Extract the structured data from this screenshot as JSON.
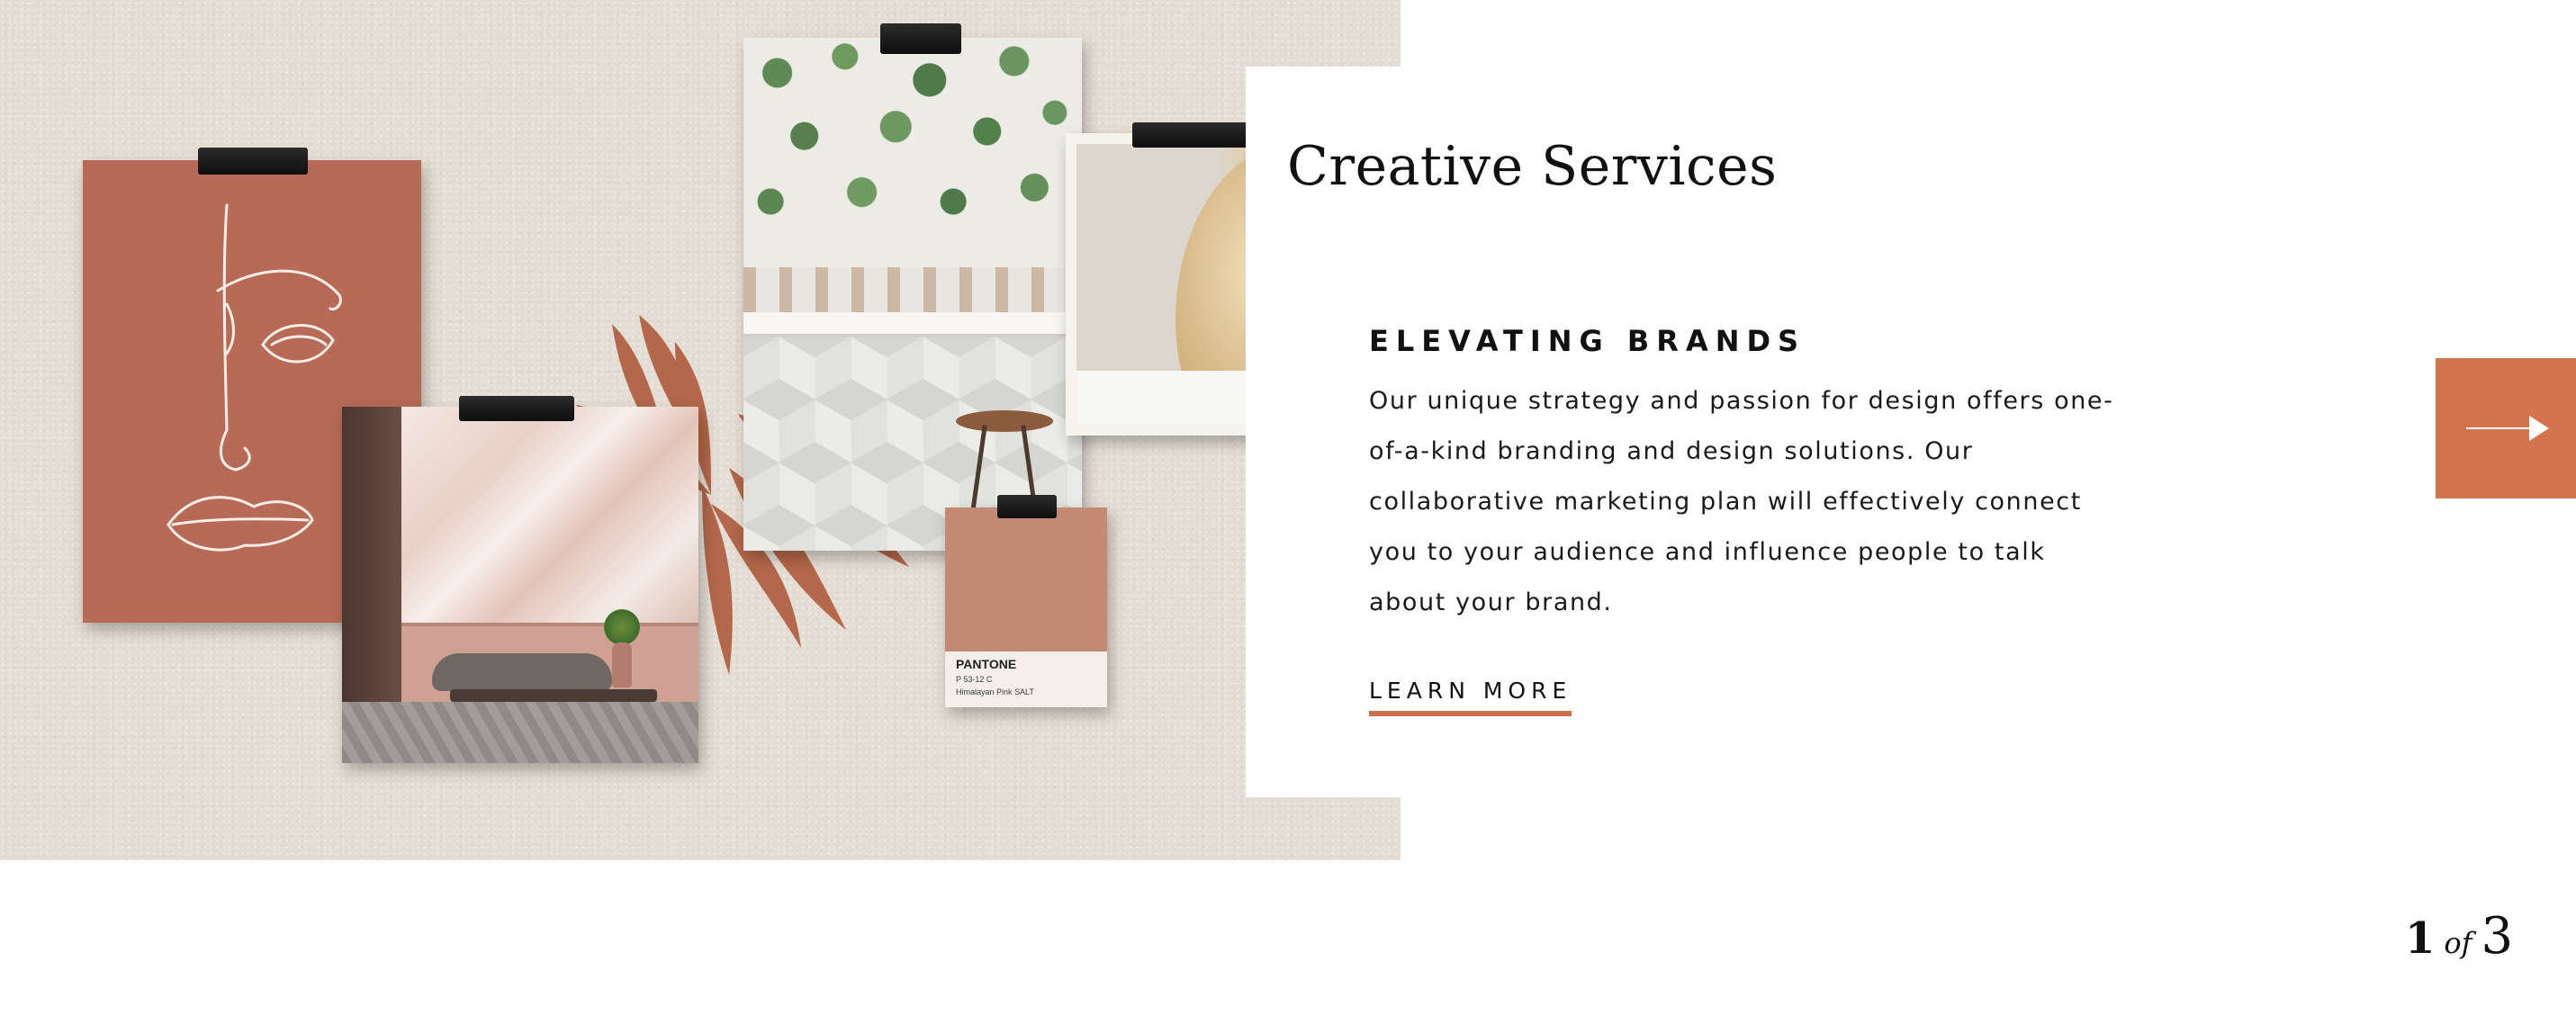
{
  "hero": {
    "title": "Creative Services",
    "eyebrow": "ELEVATING BRANDS",
    "body": "Our unique strategy and passion for design offers one-of-a-kind branding and design solutions. Our collaborative marketing plan will effectively connect you to your audience and influence people to talk about your brand.",
    "cta_label": "LEARN MORE"
  },
  "moodboard": {
    "swatch": {
      "brand": "PANTONE",
      "code": "P 53-12 C",
      "name": "Himalayan Pink SALT"
    }
  },
  "carousel": {
    "current": "1",
    "separator": "of",
    "total": "3",
    "next_icon": "arrow-right-icon"
  },
  "colors": {
    "accent": "#d2744d",
    "terracotta": "#b66a57",
    "swatch": "#c38b74",
    "backdrop": "#e4ddd4",
    "text": "#111111"
  }
}
